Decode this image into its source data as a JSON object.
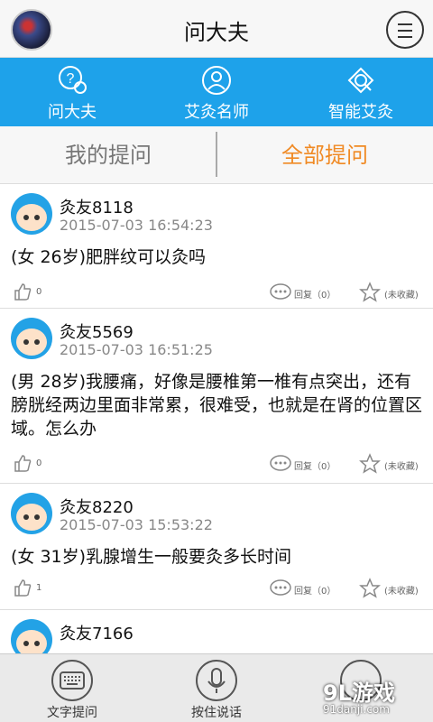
{
  "header": {
    "title": "问大夫",
    "menu_icon": "hamburger-icon"
  },
  "tabs": [
    {
      "label": "问大夫",
      "icon": "chat-bubble-icon"
    },
    {
      "label": "艾灸名师",
      "icon": "person-icon"
    },
    {
      "label": "智能艾灸",
      "icon": "search-tag-icon"
    }
  ],
  "subtabs": [
    {
      "label": "我的提问",
      "active": false
    },
    {
      "label": "全部提问",
      "active": true
    }
  ],
  "colors": {
    "primary": "#1ea2ea",
    "active_tab": "#f08a24"
  },
  "questions": [
    {
      "user": "灸友8118",
      "time": "2015-07-03 16:54:23",
      "text": "(女 26岁)肥胖纹可以灸吗",
      "likes": "0",
      "reply": "回复（0）",
      "fav": "(未收藏)"
    },
    {
      "user": "灸友5569",
      "time": "2015-07-03 16:51:25",
      "text": "(男 28岁)我腰痛，好像是腰椎第一椎有点突出，还有膀胱经两边里面非常累，很难受，也就是在肾的位置区域。怎么办",
      "likes": "0",
      "reply": "回复（0）",
      "fav": "(未收藏)"
    },
    {
      "user": "灸友8220",
      "time": "2015-07-03 15:53:22",
      "text": "(女 31岁)乳腺增生一般要灸多长时间",
      "likes": "1",
      "reply": "回复（0）",
      "fav": "(未收藏)"
    },
    {
      "user": "灸友7166",
      "time": "",
      "text": "",
      "likes": "",
      "reply": "",
      "fav": ""
    }
  ],
  "bottom": {
    "text_question": "文字提问",
    "voice_question": "按住说话"
  },
  "watermark": {
    "main": "9L游戏",
    "sub": "91danji.com"
  }
}
